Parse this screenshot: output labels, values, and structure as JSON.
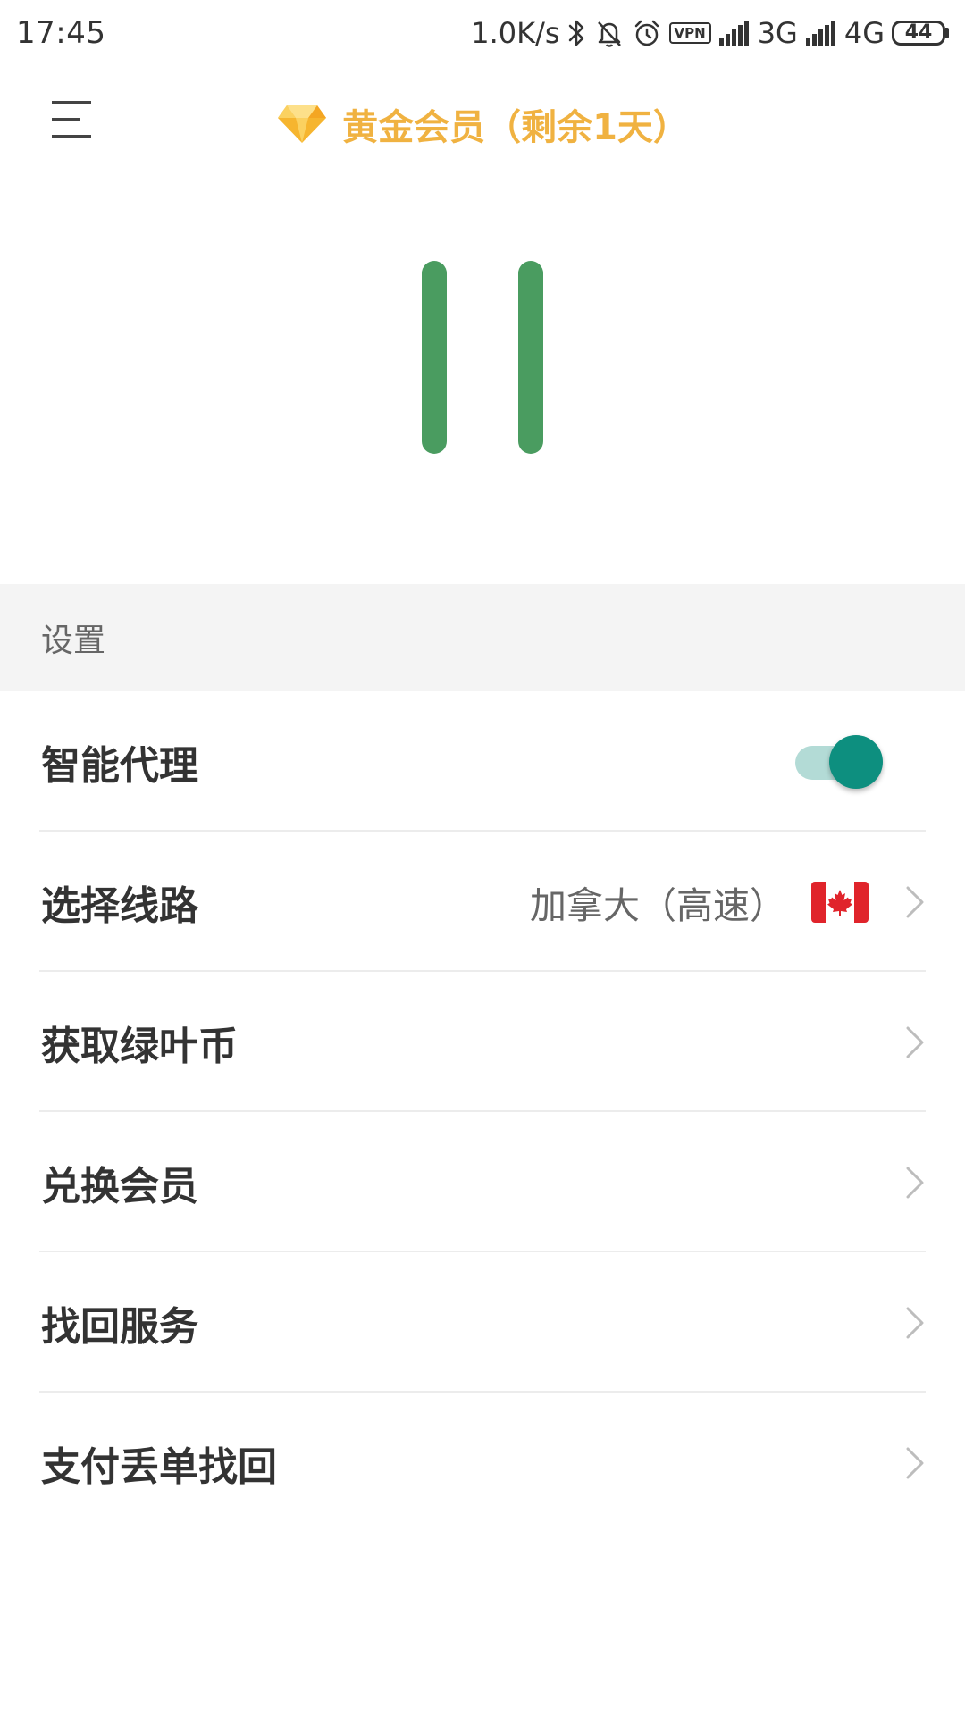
{
  "status_bar": {
    "time": "17:45",
    "net_speed": "1.0K/s",
    "vpn_label": "VPN",
    "network_1": "3G",
    "network_2": "4G",
    "battery": "44",
    "icons": [
      "bluetooth-icon",
      "mute-bell-icon",
      "alarm-icon",
      "vpn-icon",
      "signal-icon",
      "battery-icon"
    ]
  },
  "header": {
    "title": "黄金会员（剩余1天）",
    "icon": "diamond-icon",
    "menu_icon": "hamburger-menu-icon",
    "accent_color": "#f0b241"
  },
  "control": {
    "state_icon": "pause-icon",
    "color": "#4a9c60"
  },
  "settings": {
    "section_title": "设置",
    "smart_proxy": {
      "label": "智能代理",
      "enabled": true,
      "toggle_color": "#0d8f7f"
    },
    "route": {
      "label": "选择线路",
      "value": "加拿大（高速）",
      "flag": "canada-flag-icon"
    },
    "items": [
      {
        "label": "获取绿叶币"
      },
      {
        "label": "兑换会员"
      },
      {
        "label": "找回服务"
      },
      {
        "label": "支付丢单找回"
      }
    ]
  }
}
